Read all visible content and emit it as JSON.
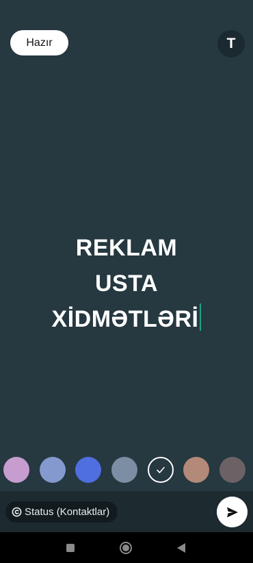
{
  "header": {
    "done_label": "Hazır",
    "text_tool_label": "T"
  },
  "status": {
    "lines": [
      "REKLAM",
      "USTA",
      "XİDMƏTLƏRİ"
    ],
    "text_color": "#ffffff",
    "background_color": "#263840",
    "caret_color": "#1fa38a"
  },
  "palette": {
    "colors": [
      "#c79dd0",
      "#8499cd",
      "#4f6fe0",
      "#7c8ea3",
      "#263840",
      "#b3897a",
      "#6c6265"
    ],
    "selected_index": 4,
    "selected_icon": "check-icon"
  },
  "footer": {
    "audience_icon": "copyright-icon",
    "audience_label": "Status (Kontaktlar)",
    "send_icon": "send-icon"
  },
  "navigation": {
    "buttons": [
      "recents-square-icon",
      "home-circle-icon",
      "back-triangle-icon"
    ]
  }
}
